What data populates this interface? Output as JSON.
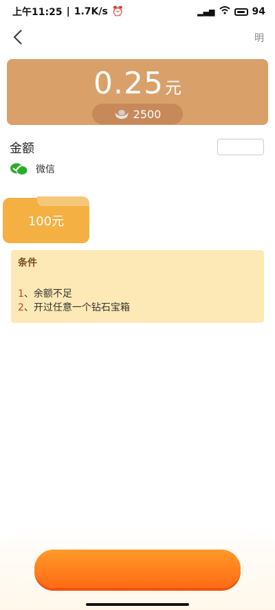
{
  "status_bar": {
    "time": "上午11:25",
    "speed": "1.7K/s",
    "battery": "94"
  },
  "nav": {
    "title": "",
    "right_text": "明"
  },
  "balance": {
    "amount": "0.25",
    "unit": "元",
    "coins": "2500"
  },
  "withdraw_section": {
    "amount_label": "金额",
    "rules_text": "",
    "wechat_label": "微信"
  },
  "option": {
    "label": "100元",
    "tag": ""
  },
  "conditions": {
    "title": "条件",
    "items": [
      {
        "num": "1",
        "text": "、余额不足"
      },
      {
        "num": "2",
        "text": "、开过任意一个钻石宝箱"
      }
    ]
  },
  "action": {
    "button_label": ""
  },
  "colors": {
    "card": "#d9a06a",
    "option": "#f4b042",
    "button": "#ff7a1e",
    "conditions_bg": "#fde9b5"
  }
}
